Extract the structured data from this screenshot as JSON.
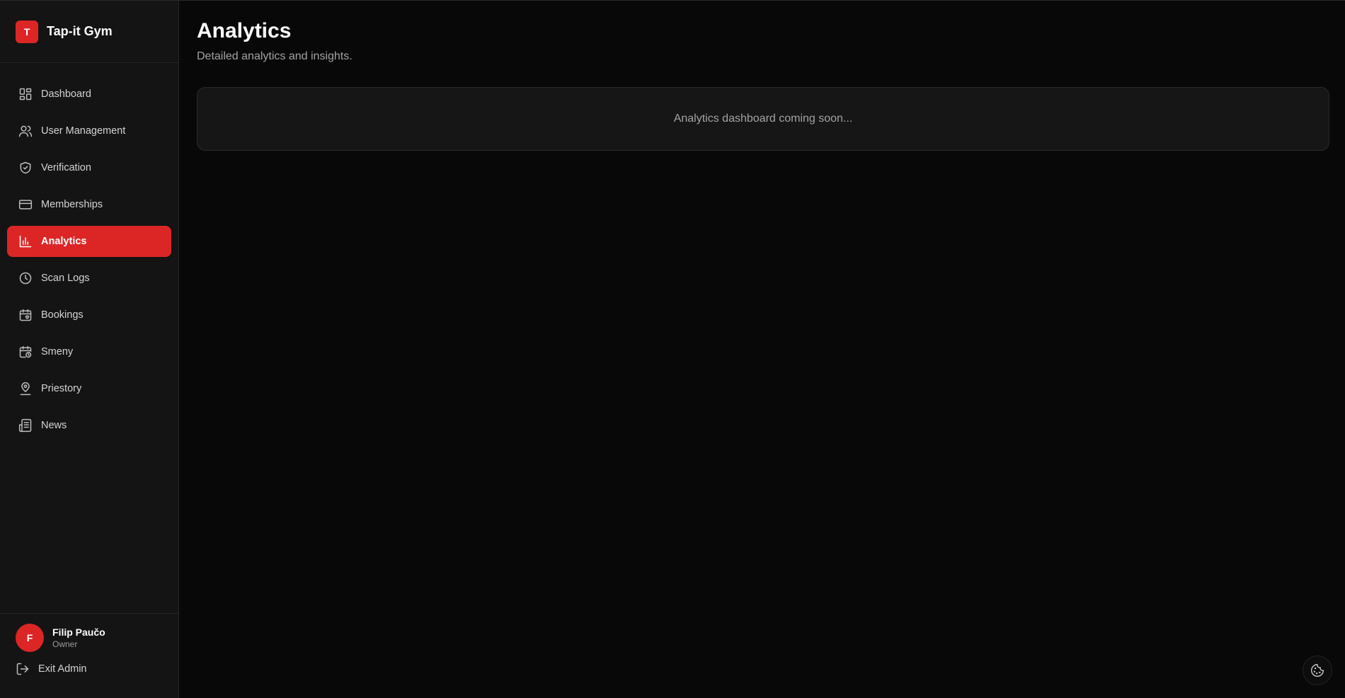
{
  "brand": {
    "logo_letter": "T",
    "name": "Tap-it Gym"
  },
  "sidebar": {
    "items": [
      {
        "label": "Dashboard",
        "icon": "dashboard-icon"
      },
      {
        "label": "User Management",
        "icon": "users-icon"
      },
      {
        "label": "Verification",
        "icon": "shield-check-icon"
      },
      {
        "label": "Memberships",
        "icon": "credit-card-icon"
      },
      {
        "label": "Analytics",
        "icon": "bar-chart-icon",
        "active": true
      },
      {
        "label": "Scan Logs",
        "icon": "clock-icon"
      },
      {
        "label": "Bookings",
        "icon": "calendar-heart-icon"
      },
      {
        "label": "Smeny",
        "icon": "calendar-clock-icon"
      },
      {
        "label": "Priestory",
        "icon": "map-pin-user-icon"
      },
      {
        "label": "News",
        "icon": "newspaper-icon"
      }
    ]
  },
  "user": {
    "avatar_letter": "F",
    "name": "Filip Paučo",
    "role": "Owner"
  },
  "footer": {
    "exit_label": "Exit Admin"
  },
  "main": {
    "title": "Analytics",
    "subtitle": "Detailed analytics and insights.",
    "placeholder": "Analytics dashboard coming soon..."
  },
  "colors": {
    "accent": "#dc2626",
    "background": "#080808",
    "sidebar_bg": "#141414"
  }
}
